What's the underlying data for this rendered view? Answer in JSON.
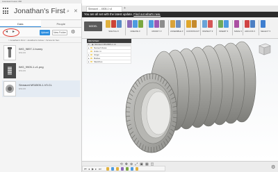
{
  "app": {
    "title": "Autodesk Fusion 360"
  },
  "data_panel": {
    "project_name": "Jonathan's First",
    "tabs": [
      {
        "label": "Data"
      },
      {
        "label": "People"
      }
    ],
    "toolbar": {
      "upload_label": "Upload",
      "new_folder_label": "New Folder"
    },
    "breadcrumb": "> Jonathan's First > Jonathan's Cubes > Screw for Sen",
    "files": [
      {
        "name": "IMG_9897-1.bunny",
        "subtitle": "8/31/15"
      },
      {
        "name": "IMG_9905-1-v1.png",
        "subtitle": "8/31/15"
      },
      {
        "name": "Sinnaunt MS4505-1-V3.CL",
        "subtitle": "8/31/15"
      }
    ]
  },
  "doc_tab": {
    "label": "Sinnaunt ... 4505-1 v4"
  },
  "banner": {
    "text": "You are all set with the latest update.",
    "link": "Find out what's new."
  },
  "toolbar": {
    "workspace": "MODEL",
    "groups": [
      {
        "label": "SKETCH",
        "colors": [
          "#e0b13f",
          "#cc4436",
          "#5b8cc4"
        ]
      },
      {
        "label": "CREATE",
        "colors": [
          "#8b6bb9",
          "#4e9be0",
          "#7aa840"
        ]
      },
      {
        "label": "MODIFY",
        "colors": [
          "#4e9be0",
          "#9b59b6",
          "#8d8d8d"
        ]
      },
      {
        "label": "ASSEMBLE",
        "colors": [
          "#d9a23a",
          "#6f8ebd"
        ]
      },
      {
        "label": "CONSTRUCT",
        "colors": [
          "#e0a82e",
          "#c58a2d"
        ]
      },
      {
        "label": "INSPECT",
        "colors": [
          "#6aa3d8",
          "#d45757"
        ]
      },
      {
        "label": "INSERT",
        "colors": [
          "#6fa95b",
          "#4e9be0"
        ]
      },
      {
        "label": "MAKE",
        "colors": [
          "#ab4fa3"
        ]
      },
      {
        "label": "ADD-INS",
        "colors": [
          "#d04343",
          "#4d7fc3"
        ]
      },
      {
        "label": "SELECT",
        "colors": [
          "#3f7fd0"
        ]
      }
    ]
  },
  "browser": {
    "header": "BROWSER",
    "root": "Sinnaunt MS4505-1 v4",
    "items": [
      "Named Views",
      "Units: in",
      "Origin",
      "Bodies",
      "Sketches"
    ]
  },
  "colors": {
    "accent_blue": "#2f8fe0",
    "banner_bg": "#2b2b2b",
    "highlight_red": "#e0352b",
    "model_gray": "#a9a9a5"
  }
}
